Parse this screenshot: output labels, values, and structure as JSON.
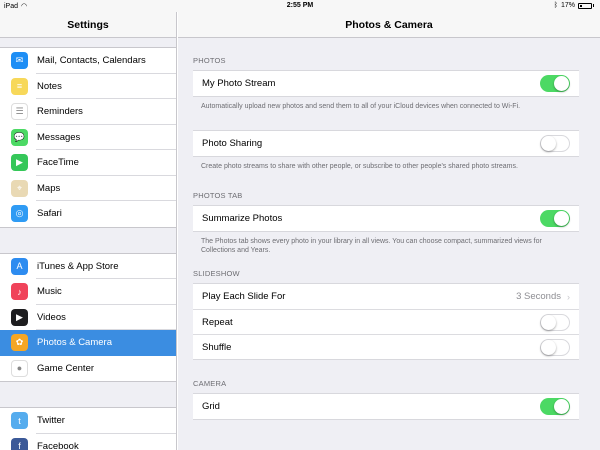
{
  "status": {
    "device": "iPad",
    "time": "2:55 PM",
    "battery": "17%"
  },
  "sidebar": {
    "title": "Settings",
    "groups": [
      [
        {
          "label": "Mail, Contacts, Calendars",
          "icon": "mail-icon",
          "color": "#1e8ef5"
        },
        {
          "label": "Notes",
          "icon": "notes-icon",
          "color": "#f7d85a"
        },
        {
          "label": "Reminders",
          "icon": "reminders-icon",
          "color": "#ffffff"
        },
        {
          "label": "Messages",
          "icon": "messages-icon",
          "color": "#4cd964"
        },
        {
          "label": "FaceTime",
          "icon": "facetime-icon",
          "color": "#35c759"
        },
        {
          "label": "Maps",
          "icon": "maps-icon",
          "color": "#e9d9b4"
        },
        {
          "label": "Safari",
          "icon": "safari-icon",
          "color": "#2f9bf4"
        }
      ],
      [
        {
          "label": "iTunes & App Store",
          "icon": "app-store-icon",
          "color": "#2d8cf0"
        },
        {
          "label": "Music",
          "icon": "music-icon",
          "color": "#f0435a"
        },
        {
          "label": "Videos",
          "icon": "videos-icon",
          "color": "#1d1d1f"
        },
        {
          "label": "Photos & Camera",
          "icon": "photos-icon",
          "color": "#f5a623",
          "active": true
        },
        {
          "label": "Game Center",
          "icon": "game-center-icon",
          "color": "#ffffff"
        }
      ],
      [
        {
          "label": "Twitter",
          "icon": "twitter-icon",
          "color": "#55acee"
        },
        {
          "label": "Facebook",
          "icon": "facebook-icon",
          "color": "#3b5998"
        }
      ]
    ]
  },
  "detail": {
    "title": "Photos & Camera",
    "photos": {
      "header": "PHOTOS",
      "my_photo_stream": "My Photo Stream",
      "my_photo_stream_on": true,
      "my_photo_stream_footer": "Automatically upload new photos and send them to all of your iCloud devices when connected to Wi-Fi.",
      "photo_sharing": "Photo Sharing",
      "photo_sharing_on": false,
      "photo_sharing_footer": "Create photo streams to share with other people, or subscribe to other people's shared photo streams."
    },
    "photos_tab": {
      "header": "PHOTOS TAB",
      "summarize": "Summarize Photos",
      "summarize_on": true,
      "footer": "The Photos tab shows every photo in your library in all views. You can choose compact, summarized views for Collections and Years."
    },
    "slideshow": {
      "header": "SLIDESHOW",
      "play_each": "Play Each Slide For",
      "play_each_value": "3 Seconds",
      "repeat": "Repeat",
      "repeat_on": false,
      "shuffle": "Shuffle",
      "shuffle_on": false
    },
    "camera": {
      "header": "CAMERA",
      "grid": "Grid",
      "grid_on": true
    }
  }
}
